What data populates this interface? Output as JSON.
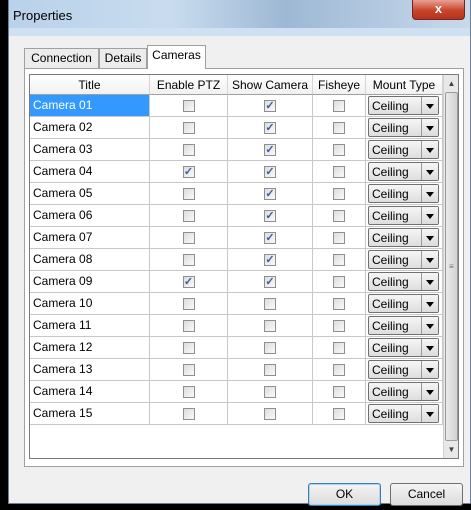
{
  "window": {
    "title": "Properties",
    "close_glyph": "x",
    "close_icon": "close-icon"
  },
  "tabs": [
    {
      "label": "Connection",
      "active": false
    },
    {
      "label": "Details",
      "active": false
    },
    {
      "label": "Cameras",
      "active": true
    }
  ],
  "grid": {
    "columns": [
      "Title",
      "Enable PTZ",
      "Show Camera",
      "Fisheye",
      "Mount Type"
    ],
    "check_mark": "✓",
    "selected_row": 0,
    "rows": [
      {
        "title": "Camera 01",
        "ptz": false,
        "show": true,
        "fisheye": false,
        "mount": "Ceiling"
      },
      {
        "title": "Camera 02",
        "ptz": false,
        "show": true,
        "fisheye": false,
        "mount": "Ceiling"
      },
      {
        "title": "Camera 03",
        "ptz": false,
        "show": true,
        "fisheye": false,
        "mount": "Ceiling"
      },
      {
        "title": "Camera 04",
        "ptz": true,
        "show": true,
        "fisheye": false,
        "mount": "Ceiling"
      },
      {
        "title": "Camera 05",
        "ptz": false,
        "show": true,
        "fisheye": false,
        "mount": "Ceiling"
      },
      {
        "title": "Camera 06",
        "ptz": false,
        "show": true,
        "fisheye": false,
        "mount": "Ceiling"
      },
      {
        "title": "Camera 07",
        "ptz": false,
        "show": true,
        "fisheye": false,
        "mount": "Ceiling"
      },
      {
        "title": "Camera 08",
        "ptz": false,
        "show": true,
        "fisheye": false,
        "mount": "Ceiling"
      },
      {
        "title": "Camera 09",
        "ptz": true,
        "show": true,
        "fisheye": false,
        "mount": "Ceiling"
      },
      {
        "title": "Camera 10",
        "ptz": false,
        "show": false,
        "fisheye": false,
        "mount": "Ceiling"
      },
      {
        "title": "Camera 11",
        "ptz": false,
        "show": false,
        "fisheye": false,
        "mount": "Ceiling"
      },
      {
        "title": "Camera 12",
        "ptz": false,
        "show": false,
        "fisheye": false,
        "mount": "Ceiling"
      },
      {
        "title": "Camera 13",
        "ptz": false,
        "show": false,
        "fisheye": false,
        "mount": "Ceiling"
      },
      {
        "title": "Camera 14",
        "ptz": false,
        "show": false,
        "fisheye": false,
        "mount": "Ceiling"
      },
      {
        "title": "Camera 15",
        "ptz": false,
        "show": false,
        "fisheye": false,
        "mount": "Ceiling"
      }
    ]
  },
  "scrollbar": {
    "up_glyph": "▲",
    "down_glyph": "▼",
    "grip_glyph": "≡"
  },
  "buttons": {
    "ok": "OK",
    "cancel": "Cancel"
  },
  "colors": {
    "selection": "#3399ff",
    "close_button": "#c9442b"
  }
}
